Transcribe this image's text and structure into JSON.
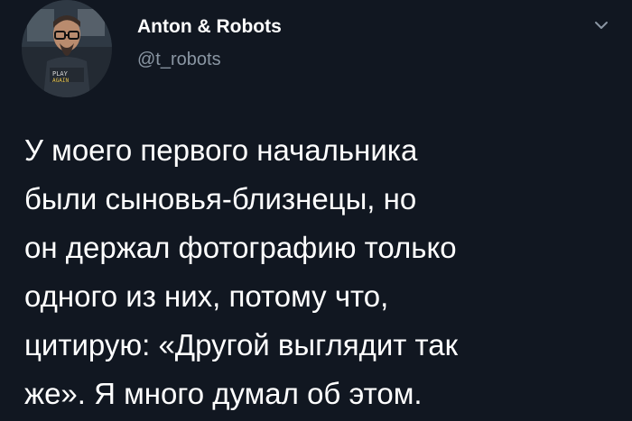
{
  "author": {
    "display_name": "Anton & Robots",
    "handle": "@t_robots",
    "avatar_shirt_text": [
      "PLAY",
      "AGAIN"
    ]
  },
  "tweet": {
    "text": "У моего первого начальника\nбыли сыновья-близнецы, но\nон держал фотографию только\nодного из них, потому что,\nцитирую: «Другой выглядит так\nже». Я много думал об этом."
  },
  "menu_icon": "chevron-down-icon"
}
